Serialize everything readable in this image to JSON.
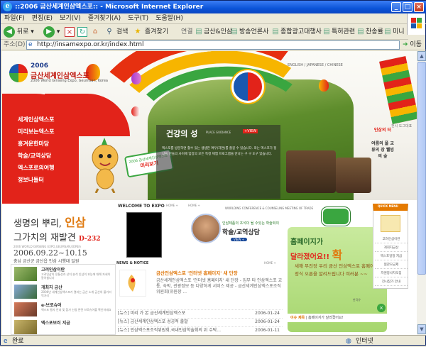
{
  "window": {
    "title": "::2006 금산세계인삼엑스포:: - Microsoft Internet Explorer"
  },
  "menu": [
    "파일(F)",
    "편집(E)",
    "보기(V)",
    "즐겨찾기(A)",
    "도구(T)",
    "도움말(H)"
  ],
  "toolbar": {
    "back": "뒤로",
    "search": "검색",
    "favorites": "즐겨찾기",
    "links_label": "연결",
    "links": [
      "금산&인삼",
      "방송언론사",
      "종합광고대행사",
      "특허관련",
      "찬송률",
      "미니홈"
    ]
  },
  "address": {
    "label": "주소(D)",
    "url": "http://insamexpo.or.kr/index.html",
    "go": "이동"
  },
  "status": {
    "left": "완료",
    "right": "인터넷"
  },
  "site": {
    "logo_year": "2006",
    "logo_name": "금산세계인삼엑스포",
    "logo_sub": "2006 World Ginseng Expo, Geumsan, Korea",
    "languages": "ENGLISH  /  JAPANESE  /  CHINESE",
    "nav": [
      "세계인삼엑스포",
      "미리보는엑스포",
      "흥겨운한마당",
      "학술/교역상담",
      "엑스포로의여행",
      "정보나들터"
    ],
    "sticker_top": "2006 금산세계인삼엑스포",
    "sticker_bottom": "미리보기",
    "guide_heading": "건강의 성",
    "guide_tag": "PLACE GUIDANCE",
    "guide_view": "+VIEW",
    "guide_text": "엑스포를 방문하면 활수 있는 생생한 여우(자연)를 즐길 수 있습니다. 와는 엑스포가 정상을 만들의 사이에 입장의 모든 특정 체험 프로그램을 만나는 구 구 도구 있습니다.",
    "sign_right": "인삼의 터",
    "sign_right_sub": "전시 도그대표",
    "sign_right2": "여름의 풀 교류의 장 웰빙의 숲",
    "dday_line1_a": "생명의 뿌리,",
    "dday_line1_b": "인삼",
    "dday_line2": "그가치의 재발견",
    "dday_label": "D-232",
    "dday_en": "2006 WORLD GINSENG EXPO,GEUMSAN,KOREA",
    "dday_dates": "2006.09.22~10.15",
    "dday_place": "충남 금산군 금산읍 인삼 시행대 일원",
    "side_items": [
      {
        "title": "고려인삼이란",
        "desc": "고려인삼의 정통성과 산지 분석 인삼의 효능에 대해 자세히 알아봅니다"
      },
      {
        "title": "개최지 금산",
        "desc": "2006년 세계인삼엑스포가 열리는 금산 소개 금산의 볼거리 먹거리"
      },
      {
        "title": "e-브로슈어",
        "desc": "엑스포 행사 안내 및 참가 신청 관련 브로슈어를 확인하세요"
      },
      {
        "title": "엑스포보러 지금",
        "desc": ""
      }
    ],
    "welcome_title": "WELCOME TO EXPO",
    "home_more": "HOME +",
    "consult_top": "WORLDING CONFERENCE & COUNSELING MEETING OF TRADE",
    "consult_sub": "인삼제품의 초석이 될 수있는 학술회의",
    "consult_title": "학술/교역상담",
    "consult_view": "VIEW +",
    "news_title": "NEWS & NOTICE",
    "news_feature_title": "금산인삼엑스포 '인터넷 홈페이지' 새 단장",
    "news_feature_body": "금산세계인삼엑스포 '인터넷 홈페이지' 새 단장 - 입부 타 인삼엑스포 교통, 숙박, 관광정보 등 다양하게 서비스 제공 - 금산세계인삼엑스포조직위원회(위원장 ...",
    "news_rows": [
      {
        "t": "[뉴스] 미리 가 본 금산세계인삼엑스포",
        "d": "2006-01-24"
      },
      {
        "t": "[뉴스] 금산세계인삼엑스포 성공적 출발",
        "d": "2006-01-24"
      },
      {
        "t": "[뉴스] 인삼엑스포조직위원회,국내인삼학술회의 위 수탁...",
        "d": "2006-01-11"
      }
    ],
    "hp_line1": "홈페이지가",
    "hp_line2": "달라졌어요!!",
    "hp_big": "확",
    "hp_note": "새해 무진장 우리 금산 인삼엑스포 홈페이지 정식 오픈을 알려드립니다 여러분 ~~",
    "hp_sign": "한국유",
    "hp_bar_a": "이슈 제목",
    "hp_bar_b": "홈페이지가 달라졌어요!",
    "quick_title": "QUICK MENU",
    "quick_items": [
      "고려인삼이란",
      "개최지금산",
      "엑스포일정 지금",
      "협찬모금제",
      "자원봉사자모집",
      "전시참가 안내"
    ]
  }
}
